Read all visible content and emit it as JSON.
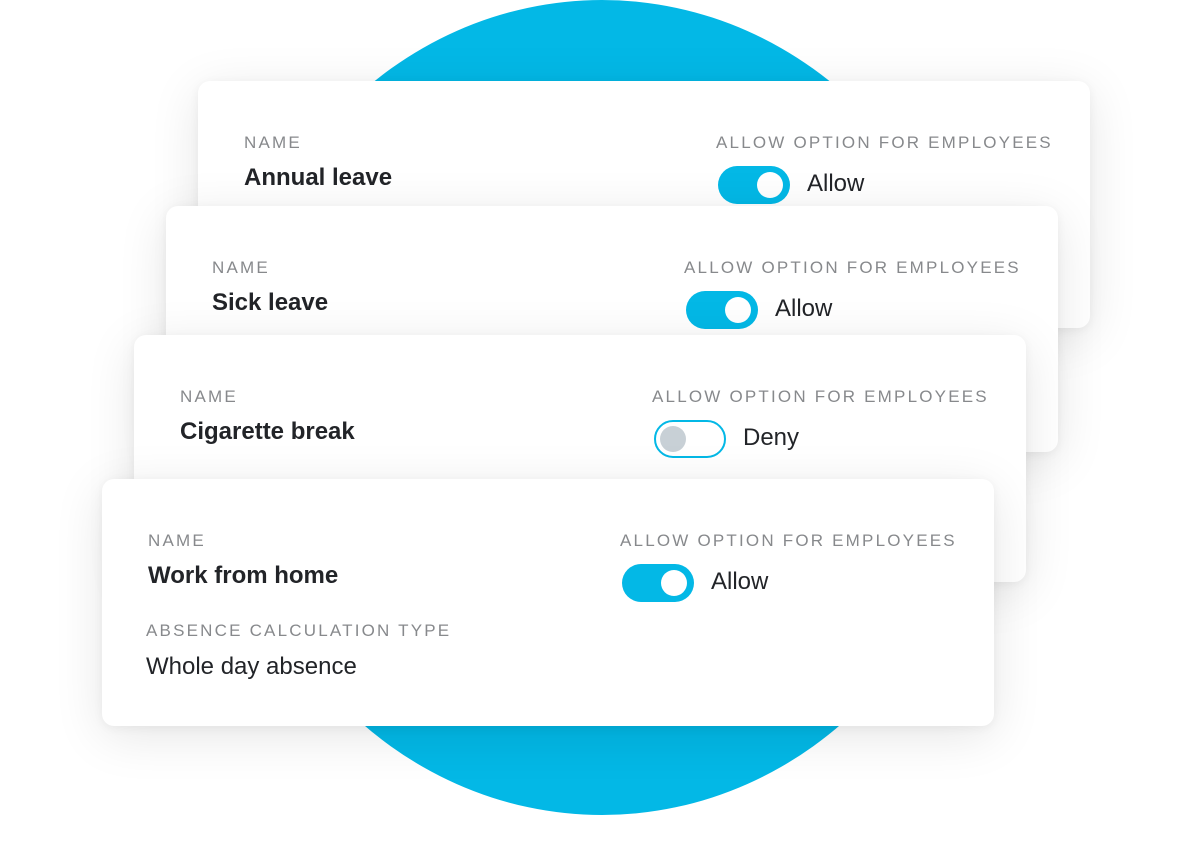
{
  "colors": {
    "accent": "#03b8e6",
    "knob_off": "#c8d0d6",
    "label_gray": "#87898c",
    "text_dark": "#222428"
  },
  "cards": [
    {
      "name_label": "NAME",
      "name_value": "Annual leave",
      "allow_label": "ALLOW OPTION FOR EMPLOYEES",
      "toggle_on": true,
      "toggle_text": "Allow"
    },
    {
      "name_label": "NAME",
      "name_value": "Sick leave",
      "allow_label": "ALLOW OPTION FOR EMPLOYEES",
      "toggle_on": true,
      "toggle_text": "Allow"
    },
    {
      "name_label": "NAME",
      "name_value": "Cigarette break",
      "allow_label": "ALLOW OPTION FOR EMPLOYEES",
      "toggle_on": false,
      "toggle_text": "Deny"
    },
    {
      "name_label": "NAME",
      "name_value": "Work from home",
      "allow_label": "ALLOW OPTION FOR EMPLOYEES",
      "toggle_on": true,
      "toggle_text": "Allow",
      "calc_label": "ABSENCE CALCULATION TYPE",
      "calc_value": "Whole day absence"
    }
  ]
}
